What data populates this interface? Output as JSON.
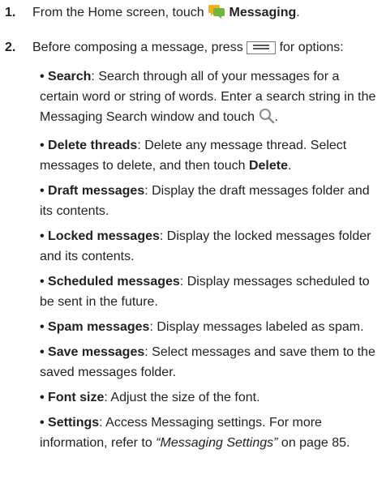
{
  "steps": [
    {
      "number": "1.",
      "before": "From the Home screen, touch ",
      "icon": "messaging-app-icon",
      "bold": "Messaging",
      "after": "."
    },
    {
      "number": "2.",
      "before": "Before composing a message, press ",
      "icon": "menu-key-icon",
      "after": " for options:"
    }
  ],
  "options": [
    {
      "term": "Search",
      "text": ": Search through all of your messages for a certain word or string of words. Enter a search string in the Messaging Search window and touch ",
      "icon": "search-icon",
      "end": "."
    },
    {
      "term": "Delete threads",
      "text": ": Delete any message thread. Select messages to delete, and then touch ",
      "bold_end": "Delete",
      "end": "."
    },
    {
      "term": "Draft messages",
      "text": ": Display the draft messages folder and its contents."
    },
    {
      "term": "Locked messages",
      "text": ": Display the locked messages folder and its contents."
    },
    {
      "term": "Scheduled messages",
      "text": ": Display messages scheduled to be sent in the future."
    },
    {
      "term": "Spam messages",
      "text": ": Display messages labeled as spam."
    },
    {
      "term": "Save messages",
      "text": ": Select messages and save them to the saved messages folder."
    },
    {
      "term": "Font size",
      "text": ": Adjust the size of the font."
    },
    {
      "term": "Settings",
      "text": ": Access Messaging settings. For more information, refer to ",
      "italic_ref": "“Messaging Settings”",
      "end": " on page 85."
    }
  ],
  "colors": {
    "text": "#231f20",
    "messaging_icon_yellow": "#f2b01e",
    "messaging_icon_green": "#6fb53f",
    "menu_icon_border": "#7a7a7a",
    "search_icon": "#8a8a8a"
  }
}
